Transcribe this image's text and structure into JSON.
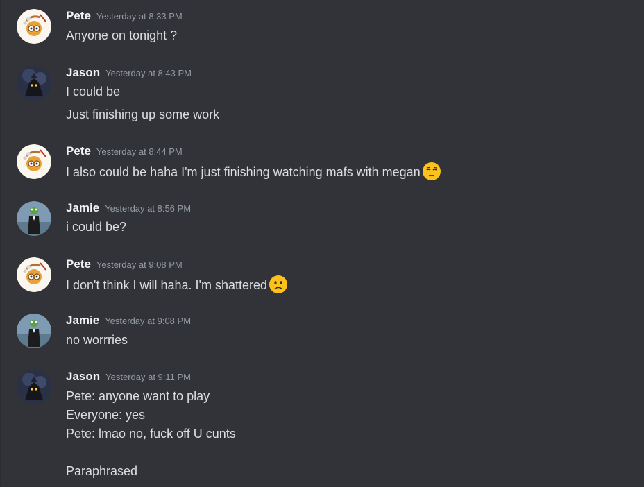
{
  "messages": [
    {
      "author": "Pete",
      "avatar": "pete-avatar",
      "timestamp": "Yesterday at 8:33 PM",
      "lines": [
        "Anyone on tonight ?"
      ]
    },
    {
      "author": "Jason",
      "avatar": "jason-avatar",
      "timestamp": "Yesterday at 8:43 PM",
      "lines": [
        "I could be",
        "Just finishing up some work"
      ]
    },
    {
      "author": "Pete",
      "avatar": "pete-avatar",
      "timestamp": "Yesterday at 8:44 PM",
      "lines": [
        "I also could be  haha I'm just finishing watching mafs with megan"
      ],
      "emoji": "unamused-face-emoji"
    },
    {
      "author": "Jamie",
      "avatar": "jamie-avatar",
      "timestamp": "Yesterday at 8:56 PM",
      "lines": [
        "i could be?"
      ]
    },
    {
      "author": "Pete",
      "avatar": "pete-avatar",
      "timestamp": "Yesterday at 9:08 PM",
      "lines": [
        "I don't think I will haha. I'm shattered"
      ],
      "emoji": "frowning-face-emoji"
    },
    {
      "author": "Jamie",
      "avatar": "jamie-avatar",
      "timestamp": "Yesterday at 9:08 PM",
      "lines": [
        "no worrries"
      ]
    },
    {
      "author": "Jason",
      "avatar": "jason-avatar",
      "timestamp": "Yesterday at 9:11 PM",
      "lines": [
        "Pete: anyone want to play",
        "Everyone: yes",
        "Pete: lmao no, fuck off U cunts",
        "",
        "Paraphrased"
      ]
    }
  ],
  "colors": {
    "background": "#313338",
    "author": "#f2f3f5",
    "timestamp": "#949ba4",
    "text": "#dbdee1",
    "emoji": "#fcc21b"
  }
}
